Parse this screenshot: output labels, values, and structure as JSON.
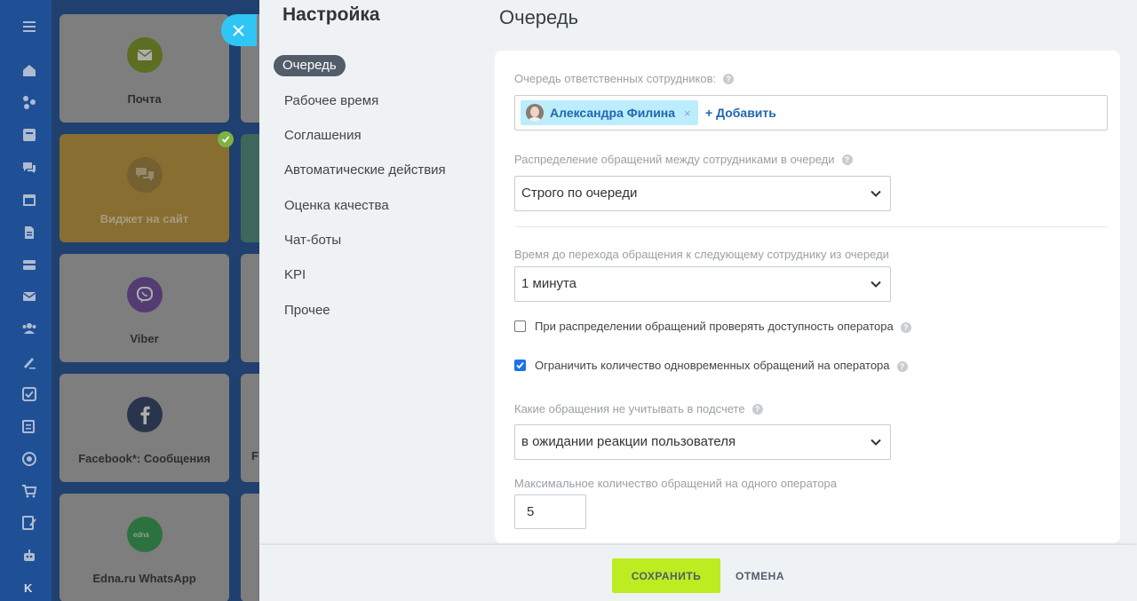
{
  "sidebar_rail": {
    "icons": [
      "menu-icon",
      "home-icon",
      "crm-icon",
      "feed-icon",
      "chat-icon",
      "calendar-icon",
      "document-icon",
      "drive-icon",
      "mail-icon",
      "contacts-icon",
      "sign-icon",
      "tasks-icon",
      "reports-icon",
      "goals-icon",
      "shop-icon",
      "forms-icon",
      "robot-icon"
    ],
    "bottom_letter": "K"
  },
  "tiles": [
    {
      "label": "Почта",
      "icon": "mail-icon",
      "color": "#7b9a1e"
    },
    {
      "label": "Виджет на сайт",
      "icon": "chat-bubbles-icon",
      "color": "#c19a2c"
    },
    {
      "label": "Viber",
      "icon": "viber-icon",
      "color": "#6d4aa0"
    },
    {
      "label": "Facebook*: Сообщения",
      "icon": "facebook-icon",
      "color": "#2c3e64"
    },
    {
      "label": "Edna.ru WhatsApp",
      "icon": "edna-icon",
      "color": "#2fa04c"
    }
  ],
  "tiles_partial_label": "F",
  "panel": {
    "title": "Настройка",
    "section_title": "Очередь",
    "menu": [
      {
        "label": "Очередь",
        "active": true
      },
      {
        "label": "Рабочее время",
        "active": false
      },
      {
        "label": "Соглашения",
        "active": false
      },
      {
        "label": "Автоматические действия",
        "active": false
      },
      {
        "label": "Оценка качества",
        "active": false
      },
      {
        "label": "Чат-боты",
        "active": false
      },
      {
        "label": "KPI",
        "active": false
      },
      {
        "label": "Прочее",
        "active": false
      }
    ]
  },
  "form": {
    "queue_label": "Очередь ответственных сотрудников:",
    "user_name": "Александра Филина",
    "user_remove": "×",
    "add_link": "+ Добавить",
    "distribution_label": "Распределение обращений между сотрудниками в очереди",
    "distribution_value": "Строго по очереди",
    "time_label": "Время до перехода обращения к следующему сотруднику из очереди",
    "time_value": "1 минута",
    "check_availability_label": "При распределении обращений проверять доступность оператора",
    "check_availability_checked": false,
    "limit_label": "Ограничить количество одновременных обращений на оператора",
    "limit_checked": true,
    "exclude_label": "Какие обращения не учитывать в подсчете",
    "exclude_value": "в ожидании реакции пользователя",
    "max_label": "Максимальное количество обращений на одного оператора",
    "max_value": "5"
  },
  "footer": {
    "save": "СОХРАНИТЬ",
    "cancel": "ОТМЕНА"
  },
  "colors": {
    "accent": "#2067b0",
    "save_button": "#bbed21",
    "close_button": "#2fc6f6",
    "checkbox": "#1a73e8"
  }
}
